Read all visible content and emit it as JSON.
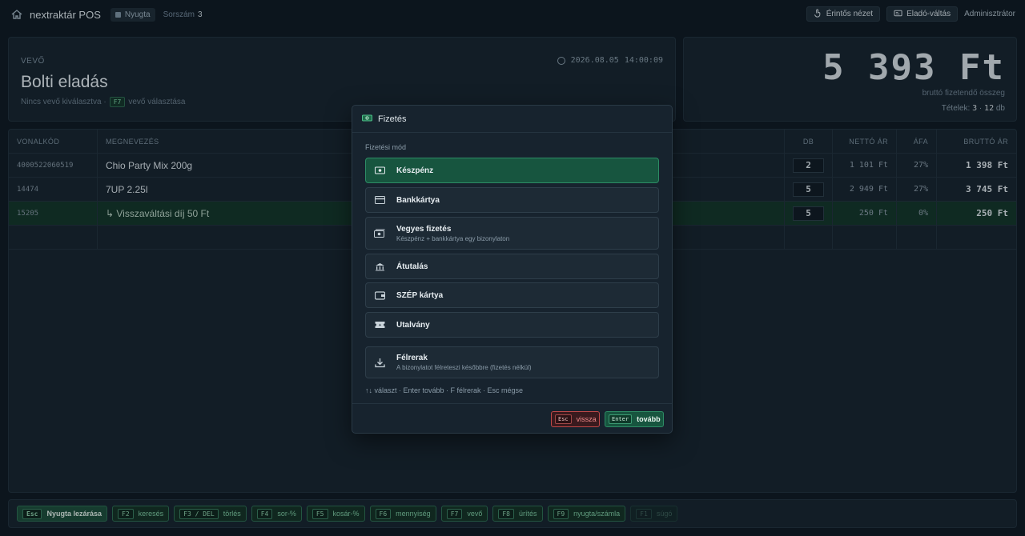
{
  "topbar": {
    "brand": "nextraktár POS",
    "receipt_pill": "Nyugta",
    "serial_label": "Sorszám",
    "serial_value": "3",
    "touch_view": "Érintős nézet",
    "seller_switch": "Eladó-váltás",
    "user": "Adminisztrátor"
  },
  "customer": {
    "label": "VEVŐ",
    "name": "Bolti eladás",
    "hint_prefix": "Nincs vevő kiválasztva ·",
    "hint_key": "F7",
    "hint_suffix": "vevő választása",
    "date": "2026.08.05",
    "time": "14:00:09"
  },
  "total": {
    "amount": "5 393 Ft",
    "label": "bruttó fizetendő összeg",
    "items_label": "Tételek:",
    "items_count": "3",
    "items_sep": "·",
    "items_qty": "12",
    "items_unit": "db"
  },
  "table": {
    "headers": {
      "code": "VONALKÓD",
      "name": "MEGNEVEZÉS",
      "qty": "DB",
      "net": "NETTÓ ÁR",
      "vat": "ÁFA",
      "gross": "BRUTTÓ ÁR"
    },
    "rows": [
      {
        "code": "4000522060519",
        "name": "Chio Party Mix 200g",
        "qty": "2",
        "net": "1 101 Ft",
        "vat": "27%",
        "gross": "1 398 Ft"
      },
      {
        "code": "14474",
        "name": "7UP 2.25l",
        "qty": "5",
        "net": "2 949 Ft",
        "vat": "27%",
        "gross": "3 745 Ft"
      },
      {
        "code": "15205",
        "name": "↳ Visszaváltási díj 50 Ft",
        "qty": "5",
        "net": "250 Ft",
        "vat": "0%",
        "gross": "250 Ft"
      }
    ]
  },
  "fkeys": [
    {
      "key": "Esc",
      "label": "Nyugta lezárása"
    },
    {
      "key": "F2",
      "label": "keresés"
    },
    {
      "key": "F3 / DEL",
      "label": "törlés"
    },
    {
      "key": "F4",
      "label": "sor-%"
    },
    {
      "key": "F5",
      "label": "kosár-%"
    },
    {
      "key": "F6",
      "label": "mennyiség"
    },
    {
      "key": "F7",
      "label": "vevő"
    },
    {
      "key": "F8",
      "label": "ürítés"
    },
    {
      "key": "F9",
      "label": "nyugta/számla"
    },
    {
      "key": "F1",
      "label": "súgó"
    }
  ],
  "modal": {
    "title": "Fizetés",
    "section": "Fizetési mód",
    "options": [
      {
        "label": "Készpénz",
        "desc": "",
        "icon": "cash-icon"
      },
      {
        "label": "Bankkártya",
        "desc": "",
        "icon": "card-icon"
      },
      {
        "label": "Vegyes fizetés",
        "desc": "Készpénz + bankkártya egy bizonylaton",
        "icon": "mixed-payment-icon"
      },
      {
        "label": "Átutalás",
        "desc": "",
        "icon": "bank-transfer-icon"
      },
      {
        "label": "SZÉP kártya",
        "desc": "",
        "icon": "wallet-icon"
      },
      {
        "label": "Utalvány",
        "desc": "",
        "icon": "voucher-icon"
      },
      {
        "label": "Félrerak",
        "desc": "A bizonylatot félreteszi későbbre (fizetés nélkül)",
        "icon": "download-icon"
      }
    ],
    "hint": "↑↓ választ · Enter tovább · F félrerak · Esc mégse",
    "back_key": "Esc",
    "back_label": "vissza",
    "next_key": "Enter",
    "next_label": "tovább"
  }
}
